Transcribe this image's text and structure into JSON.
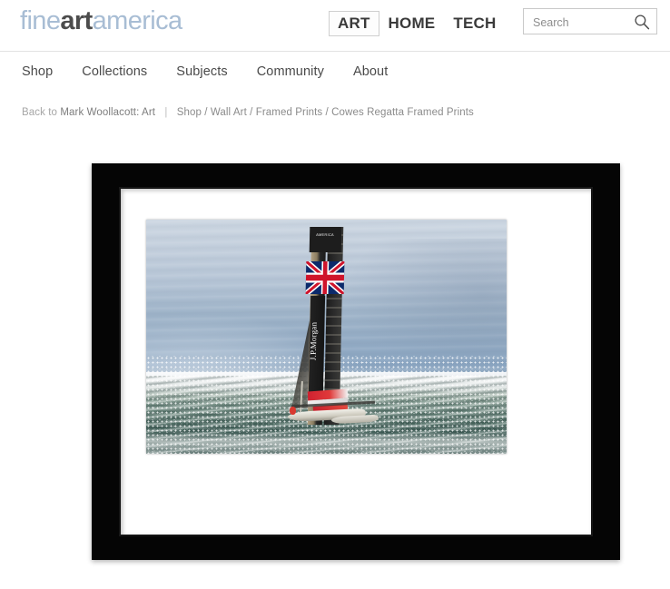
{
  "header": {
    "logo": {
      "part1": "fine",
      "part2": "art",
      "part3": "america"
    },
    "nav": [
      {
        "label": "ART",
        "active": true
      },
      {
        "label": "HOME",
        "active": false
      },
      {
        "label": "TECH",
        "active": false
      }
    ],
    "search": {
      "placeholder": "Search",
      "value": "",
      "icon": "search-icon"
    }
  },
  "subnav": {
    "items": [
      {
        "label": "Shop"
      },
      {
        "label": "Collections"
      },
      {
        "label": "Subjects"
      },
      {
        "label": "Community"
      },
      {
        "label": "About"
      }
    ]
  },
  "breadcrumb": {
    "back_prefix": "Back to",
    "back_target": "Mark Woollacott: Art",
    "separator": "|",
    "path": "Shop / Wall Art / Framed Prints / Cowes Regatta Framed Prints"
  },
  "product": {
    "frame_style": "black-wood-frame",
    "mat_color": "#ffffff",
    "frame_color": "#050505",
    "artwork": {
      "title": "Cowes Regatta",
      "subject": "J.P.Morgan America's Cup catamaran racing in rough sea",
      "sail_text": "J.P.Morgan",
      "mast_text": "AMERICA",
      "flag": "union-jack"
    }
  },
  "colors": {
    "logo_light": "#a8bdd4",
    "logo_dark": "#4c4c4c",
    "text_nav": "#3a3a3a",
    "text_breadcrumb": "#9a9a9a",
    "border": "#e2e2e2",
    "background": "#ffffff"
  }
}
